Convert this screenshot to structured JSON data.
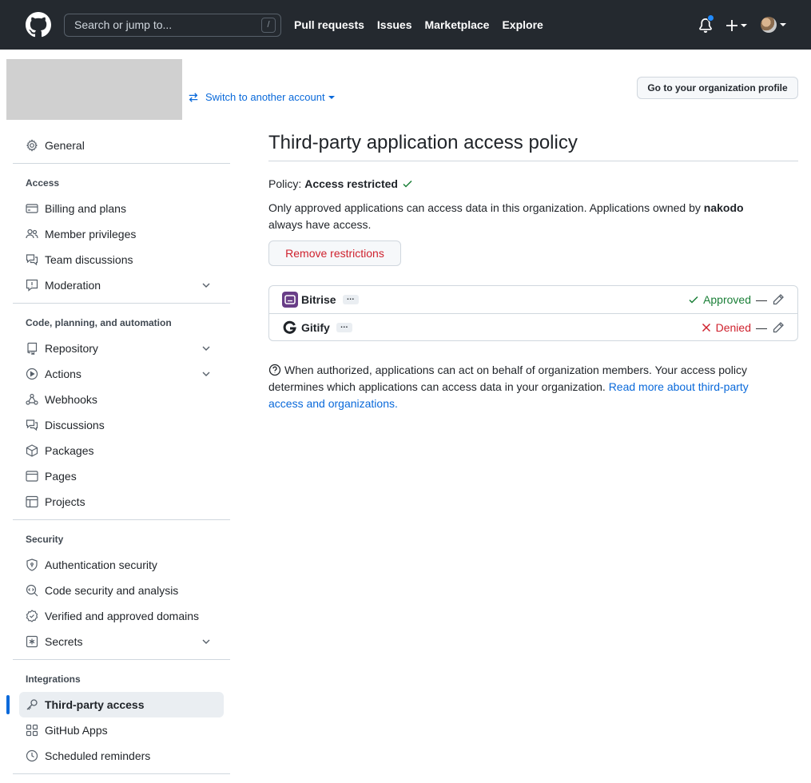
{
  "header": {
    "search_placeholder": "Search or jump to...",
    "search_shortcut": "/",
    "nav": [
      "Pull requests",
      "Issues",
      "Marketplace",
      "Explore"
    ]
  },
  "org": {
    "switch_label": "Switch to another account",
    "profile_button": "Go to your organization profile"
  },
  "sidebar": {
    "general": "General",
    "access_heading": "Access",
    "access_items": [
      "Billing and plans",
      "Member privileges",
      "Team discussions",
      "Moderation"
    ],
    "code_heading": "Code, planning, and automation",
    "code_items": [
      "Repository",
      "Actions",
      "Webhooks",
      "Discussions",
      "Packages",
      "Pages",
      "Projects"
    ],
    "security_heading": "Security",
    "security_items": [
      "Authentication security",
      "Code security and analysis",
      "Verified and approved domains",
      "Secrets"
    ],
    "integrations_heading": "Integrations",
    "integrations_items": [
      "Third-party access",
      "GitHub Apps",
      "Scheduled reminders"
    ]
  },
  "main": {
    "title": "Third-party application access policy",
    "policy_label": "Policy:",
    "policy_value": "Access restricted",
    "desc_prefix": "Only approved applications can access data in this organization. Applications owned by",
    "desc_owner": "nakodo",
    "desc_suffix": "always have access.",
    "remove_button": "Remove restrictions",
    "apps": [
      {
        "name": "Bitrise",
        "status": "Approved"
      },
      {
        "name": "Gitify",
        "status": "Denied"
      }
    ],
    "help_text": "When authorized, applications can act on behalf of organization members. Your access policy determines which applications can access data in your organization.",
    "help_link": "Read more about third-party access and organizations."
  },
  "colors": {
    "header_bg": "#24292f",
    "link": "#0969da",
    "approved": "#1a7f37",
    "denied": "#cf222e",
    "active_indicator": "#0969da"
  }
}
